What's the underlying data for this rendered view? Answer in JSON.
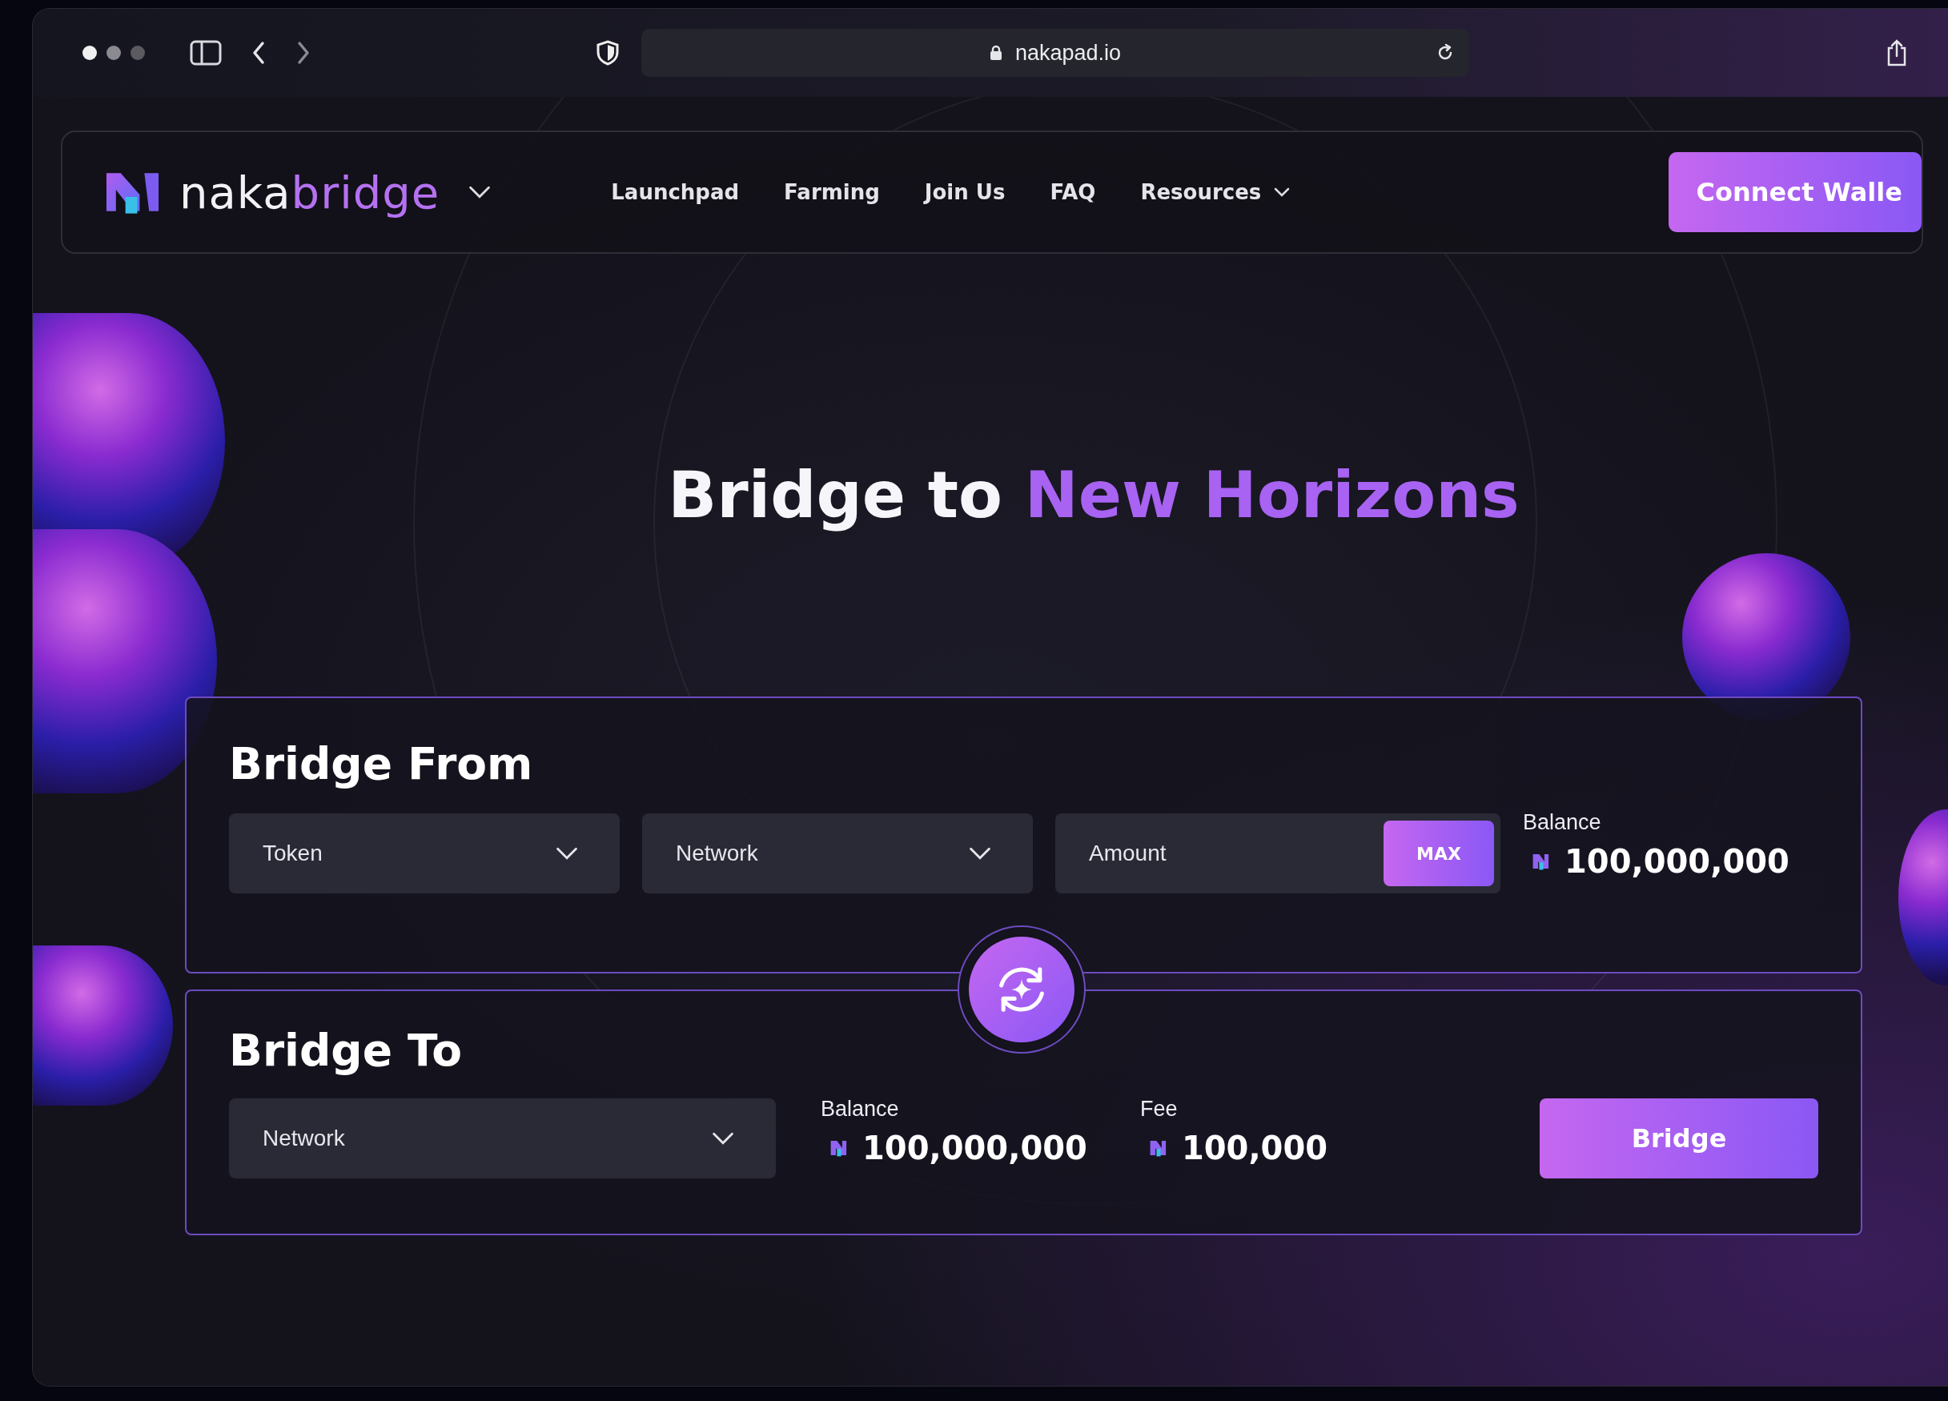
{
  "browser": {
    "url": "nakapad.io"
  },
  "nav": {
    "brand_left": "naka",
    "brand_right": "bridge",
    "links": [
      {
        "label": "Launchpad",
        "has_menu": false
      },
      {
        "label": "Farming",
        "has_menu": false
      },
      {
        "label": "Join Us",
        "has_menu": false
      },
      {
        "label": "FAQ",
        "has_menu": false
      },
      {
        "label": "Resources",
        "has_menu": true
      }
    ],
    "connect_button": "Connect Walle"
  },
  "hero": {
    "title_plain": "Bridge to",
    "title_accent": "New Horizons"
  },
  "bridge_from": {
    "title": "Bridge From",
    "fields": [
      {
        "kind": "select",
        "placeholder": "Token"
      },
      {
        "kind": "select",
        "placeholder": "Network"
      },
      {
        "kind": "amount",
        "placeholder": "Amount",
        "button": "MAX"
      }
    ],
    "balance_label": "Balance",
    "balance_value": "100,000,000"
  },
  "bridge_to": {
    "title": "Bridge To",
    "network_placeholder": "Network",
    "stats": [
      {
        "label": "Balance",
        "value": "100,000,000"
      },
      {
        "label": "Fee",
        "value": "100,000"
      }
    ],
    "button": "Bridge"
  }
}
